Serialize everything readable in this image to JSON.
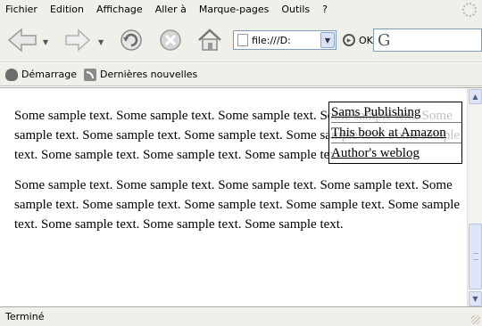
{
  "menubar": {
    "items": [
      {
        "label": "Fichier"
      },
      {
        "label": "Edition"
      },
      {
        "label": "Affichage"
      },
      {
        "label": "Aller à"
      },
      {
        "label": "Marque-pages"
      },
      {
        "label": "Outils"
      },
      {
        "label": "?"
      }
    ]
  },
  "navbar": {
    "url": "file:///D:",
    "go_label": "OK",
    "search_engine_glyph": "G",
    "icons": {
      "back": "back-arrow-icon",
      "forward": "forward-arrow-icon",
      "reload": "reload-icon",
      "stop": "stop-icon",
      "home": "home-icon",
      "page": "page-icon",
      "go": "go-icon"
    }
  },
  "bookmarks": {
    "items": [
      {
        "label": "Démarrage",
        "icon": "start-icon"
      },
      {
        "label": "Dernières nouvelles",
        "icon": "rss-icon"
      }
    ]
  },
  "content": {
    "paragraphs": [
      "Some sample text. Some sample text. Some sample text. Some sample text. Some sample text. Some sample text. Some sample text. Some sample text. Some sample text. Some sample text. Some sample text. Some sample text.",
      "Some sample text. Some sample text. Some sample text. Some sample text. Some sample text. Some sample text. Some sample text. Some sample text. Some sample text. Some sample text. Some sample text. Some sample text."
    ],
    "links": [
      {
        "label": "Sams Publishing"
      },
      {
        "label": "This book at Amazon"
      },
      {
        "label": "Author's weblog"
      }
    ]
  },
  "status": {
    "text": "Terminé"
  }
}
